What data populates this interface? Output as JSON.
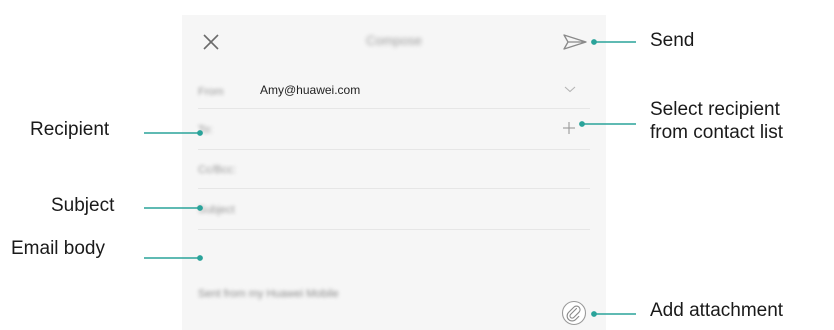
{
  "compose": {
    "title": "Compose",
    "from_label": "From",
    "from_value": "Amy@huawei.com",
    "to_label": "To:",
    "cc_label": "Cc/Bcc:",
    "subject_label": "Subject",
    "signature": "Sent from my Huawei Mobile"
  },
  "icons": {
    "close": "close-icon",
    "send": "send-icon",
    "chevron": "chevron-down-icon",
    "add": "plus-icon",
    "attach": "paperclip-icon"
  },
  "callouts": {
    "send": "Send",
    "select_line1": "Select recipient",
    "select_line2": "from contact list",
    "recipient": "Recipient",
    "subject": "Subject",
    "body": "Email body",
    "attachment": "Add attachment"
  },
  "colors": {
    "accent": "#2aa39a",
    "panel": "#f6f6f6",
    "icon_gray": "#8a8a8a"
  }
}
